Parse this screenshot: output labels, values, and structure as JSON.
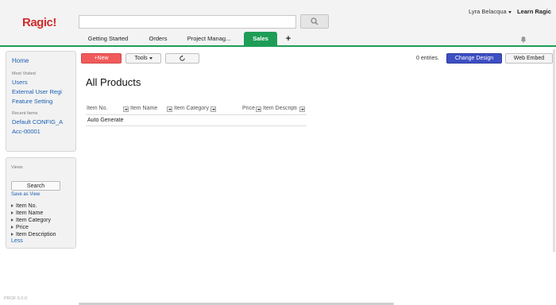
{
  "header": {
    "logo": "Ragic!",
    "search_placeholder": "",
    "user_name": "Lyra Belacqua",
    "learn_link": "Learn Ragic",
    "tabs": [
      {
        "label": "Getting Started"
      },
      {
        "label": "Orders"
      },
      {
        "label": "Project Manag..."
      },
      {
        "label": "Sales"
      },
      {
        "label": "+"
      }
    ],
    "active_tab": "Sales",
    "accent_color": "#1e9d57"
  },
  "sidebar": {
    "home": "Home",
    "most_visited_label": "Most Visited",
    "most_visited": [
      "Users",
      "External User Regi",
      "Feature Setting"
    ],
    "recent_label": "Recent Items",
    "recent": [
      "Default CONFIG_A",
      "Acc-00001"
    ],
    "views_label": "Views",
    "search_button": "Search",
    "save_view": "Save as View",
    "fields": [
      "Item No.",
      "Item Name",
      "Item Category",
      "Price",
      "Item Description"
    ],
    "less_link": "Less",
    "version": "PROF 6.0.0"
  },
  "toolbar": {
    "new_label": "+New",
    "tools_label": "Tools",
    "entries": "0 entries.",
    "change_design": "Change Design",
    "web_embed": "Web Embed"
  },
  "main": {
    "title": "All Products",
    "columns": [
      "Item No.",
      "Item Name",
      "Item Category",
      "Price",
      "Item Descripti"
    ],
    "rows": [
      [
        "Auto Generate"
      ]
    ]
  },
  "colors": {
    "new_button": "#f15a5a",
    "design_button": "#3d4fc2",
    "link": "#1a5fb4",
    "logo": "#d12b2b"
  }
}
